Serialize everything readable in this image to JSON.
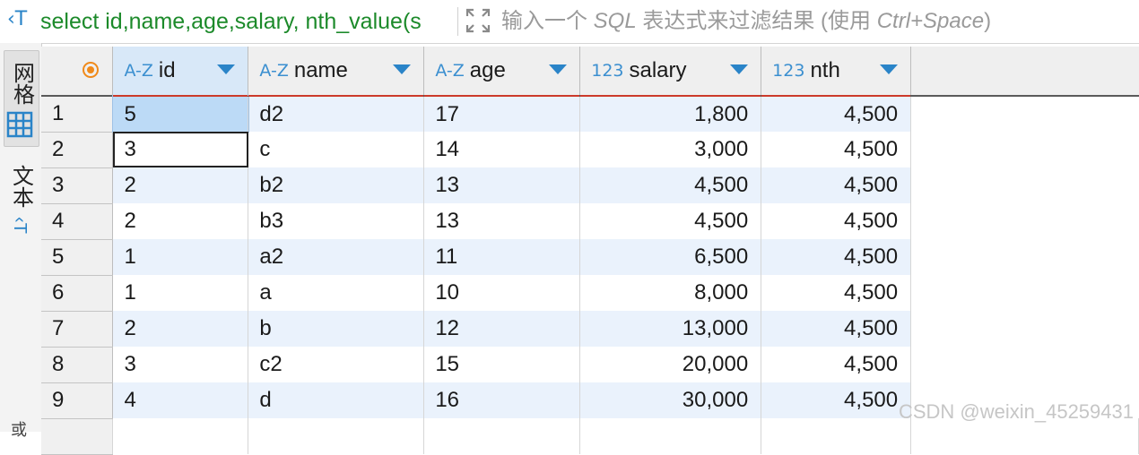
{
  "toolbar": {
    "sql_preview": "select id,name,age,salary, nth_value(s",
    "filter_placeholder_prefix": "输入一个 ",
    "filter_placeholder_sql": "SQL",
    "filter_placeholder_mid": " 表达式来过滤结果 (使用 ",
    "filter_placeholder_key": "Ctrl+Space",
    "filter_placeholder_suffix": ")"
  },
  "sidebar": {
    "grid_tab": "网格",
    "text_tab": "文本",
    "bottom_label": "或"
  },
  "columns": [
    {
      "type": "A-Z",
      "name": "id"
    },
    {
      "type": "A-Z",
      "name": "name"
    },
    {
      "type": "A-Z",
      "name": "age"
    },
    {
      "type": "123",
      "name": "salary"
    },
    {
      "type": "123",
      "name": "nth"
    }
  ],
  "rows": [
    {
      "n": "1",
      "id": "5",
      "name": "d2",
      "age": "17",
      "salary": "1,800",
      "nth": "4,500"
    },
    {
      "n": "2",
      "id": "3",
      "name": "c",
      "age": "14",
      "salary": "3,000",
      "nth": "4,500"
    },
    {
      "n": "3",
      "id": "2",
      "name": "b2",
      "age": "13",
      "salary": "4,500",
      "nth": "4,500"
    },
    {
      "n": "4",
      "id": "2",
      "name": "b3",
      "age": "13",
      "salary": "4,500",
      "nth": "4,500"
    },
    {
      "n": "5",
      "id": "1",
      "name": "a2",
      "age": "11",
      "salary": "6,500",
      "nth": "4,500"
    },
    {
      "n": "6",
      "id": "1",
      "name": "a",
      "age": "10",
      "salary": "8,000",
      "nth": "4,500"
    },
    {
      "n": "7",
      "id": "2",
      "name": "b",
      "age": "12",
      "salary": "13,000",
      "nth": "4,500"
    },
    {
      "n": "8",
      "id": "3",
      "name": "c2",
      "age": "15",
      "salary": "20,000",
      "nth": "4,500"
    },
    {
      "n": "9",
      "id": "4",
      "name": "d",
      "age": "16",
      "salary": "30,000",
      "nth": "4,500"
    }
  ],
  "watermark": "CSDN @weixin_45259431"
}
